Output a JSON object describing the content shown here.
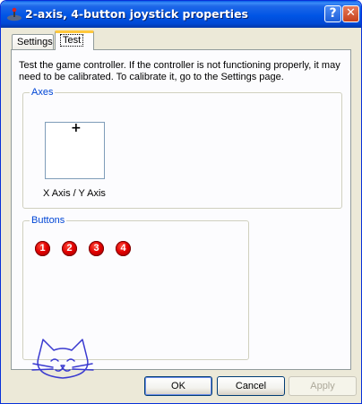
{
  "window": {
    "title": "2-axis, 4-button joystick properties",
    "help_glyph": "?",
    "close_glyph": "✕"
  },
  "tabs": [
    {
      "label": "Settings",
      "selected": false
    },
    {
      "label": "Test",
      "selected": true
    }
  ],
  "intro_text": "Test the game controller.  If the controller is not functioning properly, it may need to be calibrated.  To calibrate it, go to the Settings page.",
  "axes": {
    "group_label": "Axes",
    "crosshair_glyph": "+",
    "axis_label": "X Axis / Y Axis"
  },
  "buttons_group": {
    "group_label": "Buttons",
    "buttons": [
      "1",
      "2",
      "3",
      "4"
    ]
  },
  "footer": {
    "ok_label": "OK",
    "cancel_label": "Cancel",
    "apply_label": "Apply",
    "apply_enabled": false
  },
  "colors": {
    "titlebar": "#0055e5",
    "group_label": "#0046d5",
    "joystick_button": "#e00000",
    "cat_doodle": "#3a3ad0"
  }
}
